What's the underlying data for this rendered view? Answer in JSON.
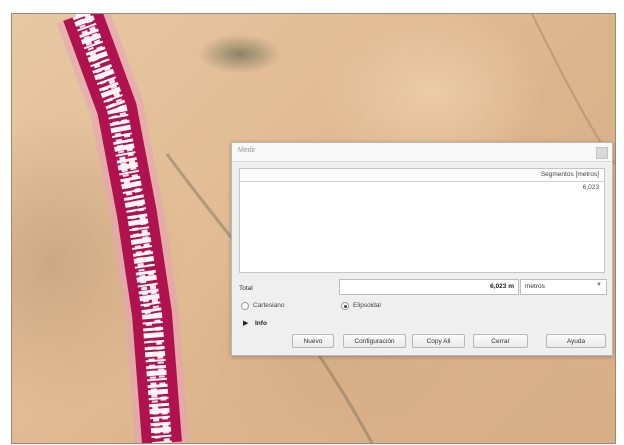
{
  "dialog": {
    "title": "Medir",
    "table": {
      "column_header": "Segmentos [metros]",
      "rows": [
        "6,023"
      ]
    },
    "total_label": "Total",
    "total_value": "6,023 m",
    "unit_selected": "metros",
    "radio_cartesian": "Cartesiano",
    "radio_ellipsoidal": "Elipsoidal",
    "selected_radio": "Elipsoidal",
    "info_label": "Info",
    "buttons": {
      "new": "Nuevo",
      "config": "Configuración",
      "copy_all": "Copy All",
      "close": "Cerrar",
      "help": "Ayuda"
    }
  },
  "colors": {
    "measure_line": "#c2185b",
    "map_base": "#e2bd95"
  }
}
